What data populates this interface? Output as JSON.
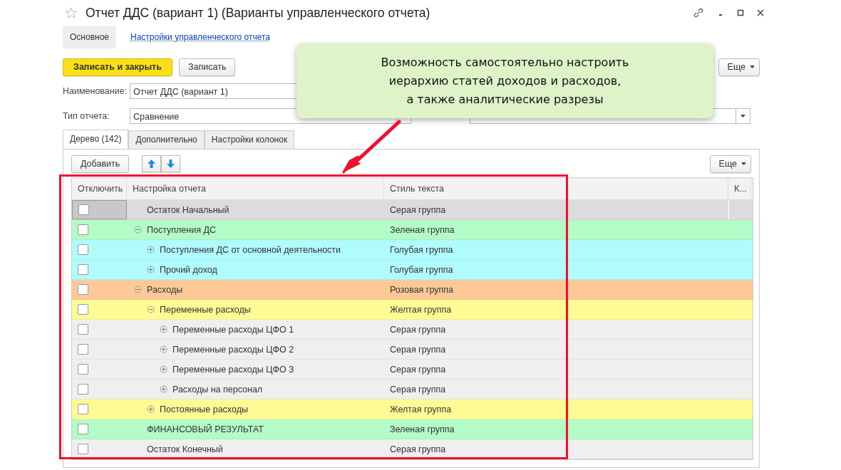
{
  "window": {
    "title": "Отчет ДДС (вариант 1) (Варианты управленческого отчета)",
    "favorite": false
  },
  "nav": [
    {
      "label": "Основное",
      "selected": true
    },
    {
      "label": "Настройки управленческого отчета",
      "selected": false
    }
  ],
  "toolbar": {
    "save_close": "Записать и закрыть",
    "save": "Записать",
    "more": "Еще"
  },
  "fields": {
    "name_label": "Наименование:",
    "name_value": "Отчет ДДС (вариант 1)",
    "type_label": "Тип отчета:",
    "type_value": "Сравнение"
  },
  "tabs": [
    {
      "label": "Дерево (142)",
      "selected": true
    },
    {
      "label": "Дополнительно",
      "selected": false
    },
    {
      "label": "Настройки колонок",
      "selected": false
    }
  ],
  "tree_toolbar": {
    "add": "Добавить",
    "more": "Еще"
  },
  "table": {
    "columns": [
      "Отключить",
      "Настройка отчета",
      "Стиль текста",
      "К..."
    ],
    "rows": [
      {
        "kind": "item",
        "label": "Остаток Начальный",
        "style": "Серая группа",
        "color": "#dcdcdc",
        "checked": false,
        "selected": true
      },
      {
        "kind": "group",
        "label": "Поступления ДС",
        "style": "Зеленая группа",
        "color": "#b3fbc7",
        "checked": false,
        "selected": false,
        "expanded": true,
        "children": [
          {
            "kind": "group",
            "label": "Поступления ДС от основной деятельности",
            "style": "Голубая группа",
            "color": "#b0fbfb",
            "checked": false,
            "selected": false,
            "expanded": false
          },
          {
            "kind": "group",
            "label": "Прочий доход",
            "style": "Голубая группа",
            "color": "#b0fbfb",
            "checked": false,
            "selected": false,
            "expanded": false
          }
        ]
      },
      {
        "kind": "group",
        "label": "Расходы",
        "style": "Розовая группа",
        "color": "#fdca97",
        "checked": false,
        "selected": false,
        "expanded": true,
        "children": [
          {
            "kind": "group",
            "label": "Переменные расходы",
            "style": "Желтая группа",
            "color": "#fefb94",
            "checked": false,
            "selected": false,
            "expanded": true,
            "children": [
              {
                "kind": "group",
                "label": "Переменные расходы ЦФО 1",
                "style": "Серая группа",
                "color": "#efefef",
                "checked": false,
                "selected": false,
                "expanded": false
              },
              {
                "kind": "group",
                "label": "Переменные расходы ЦФО 2",
                "style": "Серая группа",
                "color": "#efefef",
                "checked": false,
                "selected": false,
                "expanded": false
              },
              {
                "kind": "group",
                "label": "Переменные расходы ЦФО 3",
                "style": "Серая группа",
                "color": "#efefef",
                "checked": false,
                "selected": false,
                "expanded": false
              },
              {
                "kind": "group",
                "label": "Расходы на персонал",
                "style": "Серая группа",
                "color": "#efefef",
                "checked": false,
                "selected": false,
                "expanded": false
              }
            ]
          },
          {
            "kind": "group",
            "label": "Постоянные расходы",
            "style": "Желтая группа",
            "color": "#fefb94",
            "checked": false,
            "selected": false,
            "expanded": false
          }
        ]
      },
      {
        "kind": "item",
        "label": "ФИНАНСОВЫЙ РЕЗУЛЬТАТ",
        "style": "Зеленая группа",
        "color": "#b3fbc7",
        "checked": false,
        "selected": false
      },
      {
        "kind": "item",
        "label": "Остаток Конечный",
        "style": "Серая группа",
        "color": "#efefef",
        "checked": false,
        "selected": false
      }
    ]
  },
  "callout": {
    "lines": [
      "Возможность самостоятельно настроить",
      "иерархию статей доходов и расходов,",
      "а также аналитические разрезы"
    ]
  }
}
